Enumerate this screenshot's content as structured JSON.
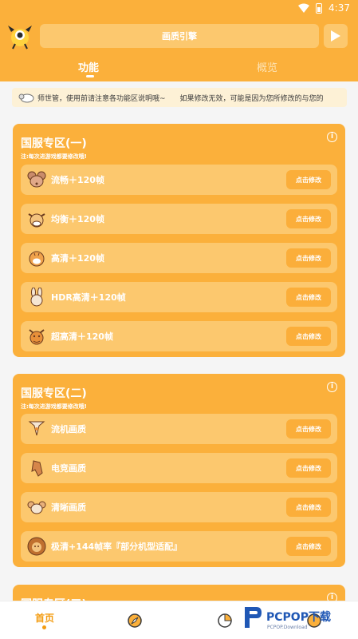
{
  "status_bar": {
    "time": "4:37"
  },
  "header": {
    "title": "画质引擎",
    "tabs": [
      {
        "label": "功能",
        "active": true
      },
      {
        "label": "概览",
        "active": false
      }
    ]
  },
  "notice": {
    "text": "师世管，使用前请注意各功能区说明哦~　　如果修改无效，可能是因为您所修改的与您的"
  },
  "sections": [
    {
      "title": "国服专区(一)",
      "subtitle": "注:每次进游戏都要修改哦!",
      "items": [
        {
          "icon": "mouse-icon",
          "label": "流畅＋120帧",
          "button": "点击修改"
        },
        {
          "icon": "ox-icon",
          "label": "均衡＋120帧",
          "button": "点击修改"
        },
        {
          "icon": "tiger-icon",
          "label": "高清＋120帧",
          "button": "点击修改"
        },
        {
          "icon": "rabbit-icon",
          "label": "HDR高清＋120帧",
          "button": "点击修改"
        },
        {
          "icon": "dragon-icon",
          "label": "超高清＋120帧",
          "button": "点击修改"
        }
      ]
    },
    {
      "title": "国服专区(二)",
      "subtitle": "注:每次进游戏都要修改哦!",
      "items": [
        {
          "icon": "snake-icon",
          "label": "流机画质",
          "button": "点击修改"
        },
        {
          "icon": "horse-icon",
          "label": "电竞画质",
          "button": "点击修改"
        },
        {
          "icon": "goat-icon",
          "label": "清晰画质",
          "button": "点击修改"
        },
        {
          "icon": "lion-icon",
          "label": "极清+144帧率『部分机型适配』",
          "button": "点击修改"
        }
      ]
    },
    {
      "title": "国服专区(三)"
    }
  ],
  "bottom_nav": {
    "home_label": "首页"
  },
  "watermark": {
    "brand": "PCPOP下载",
    "sub": "PCPOP.Download"
  },
  "colors": {
    "primary": "#fbb03b",
    "card": "#fcc86e",
    "accent": "#f39c12"
  }
}
